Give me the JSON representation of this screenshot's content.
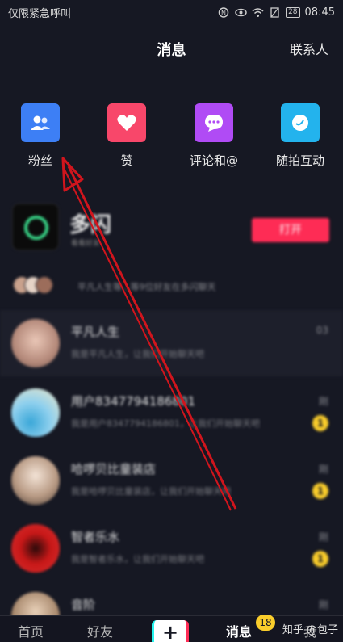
{
  "status_bar": {
    "carrier": "仅限紧急呼叫",
    "battery": "28",
    "time": "08:45"
  },
  "header": {
    "title": "消息",
    "contacts": "联系人"
  },
  "categories": [
    {
      "label": "粉丝",
      "icon": "fans-icon",
      "color": "#3d7ff5"
    },
    {
      "label": "赞",
      "icon": "heart-icon",
      "color": "#f8476a"
    },
    {
      "label": "评论和@",
      "icon": "comment-icon",
      "color": "#b04bf5"
    },
    {
      "label": "随拍互动",
      "icon": "camera-icon",
      "color": "#23b3ed"
    }
  ],
  "banner": {
    "name": "多闪",
    "tag": "看看好友",
    "button": "打开",
    "sub": "平凡人生等...等9位好友在多闪聊天"
  },
  "messages": [
    {
      "name": "平凡人生",
      "text": "我是平凡人生，让我们开始聊天吧",
      "time": "03",
      "badge": ""
    },
    {
      "name": "用户8347794186801",
      "text": "我是用户8347794186801，让我们开始聊天吧",
      "time": "刚",
      "badge": "1"
    },
    {
      "name": "哈啰贝比童装店",
      "text": "我是哈啰贝比童装店，让我们开始聊天吧",
      "time": "刚",
      "badge": "1"
    },
    {
      "name": "智者乐水",
      "text": "我是智者乐水，让我们开始聊天吧",
      "time": "刚",
      "badge": "1"
    },
    {
      "name": "音阶",
      "text": "",
      "time": "刚",
      "badge": ""
    }
  ],
  "bottom_nav": {
    "home": "首页",
    "friends": "好友",
    "plus": "+",
    "messages": "消息",
    "me": "我",
    "badge": "18",
    "watermark": "知乎 @包子"
  },
  "annotation": {
    "color": "#d0151d"
  }
}
